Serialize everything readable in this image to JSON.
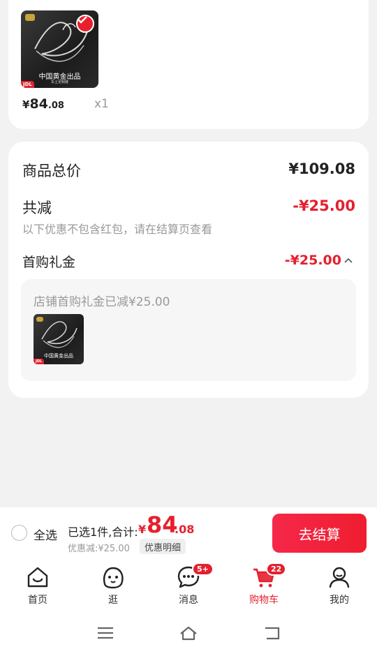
{
  "product": {
    "price_yen": "¥",
    "price_int": "84",
    "price_dec": ".08",
    "quantity": "x1",
    "image_title": "中国黄金出品",
    "image_sub": "东土定制链",
    "tag": "JDL"
  },
  "summary": {
    "total_label": "商品总价",
    "total_value": "¥109.08",
    "discount_label": "共减",
    "discount_value": "-¥25.00",
    "discount_note": "以下优惠不包含红包，请在结算页查看",
    "gift_label": "首购礼金",
    "gift_value": "-¥25.00",
    "gift_desc": "店铺首购礼金已减¥25.00"
  },
  "checkout": {
    "select_all": "全选",
    "selected_text": "已选1件,合计:",
    "total_yen": "¥",
    "total_int": "84",
    "total_dec": ".08",
    "discount_text": "优惠减:¥25.00",
    "detail_label": "优惠明细",
    "button_label": "去结算"
  },
  "tabs": [
    {
      "label": "首页",
      "icon": "home-icon"
    },
    {
      "label": "逛",
      "icon": "face-icon"
    },
    {
      "label": "消息",
      "icon": "message-icon",
      "badge": "5+"
    },
    {
      "label": "购物车",
      "icon": "cart-icon",
      "badge": "22",
      "active": true
    },
    {
      "label": "我的",
      "icon": "profile-icon"
    }
  ],
  "colors": {
    "accent": "#e5202e",
    "background": "#f2f2f2"
  }
}
